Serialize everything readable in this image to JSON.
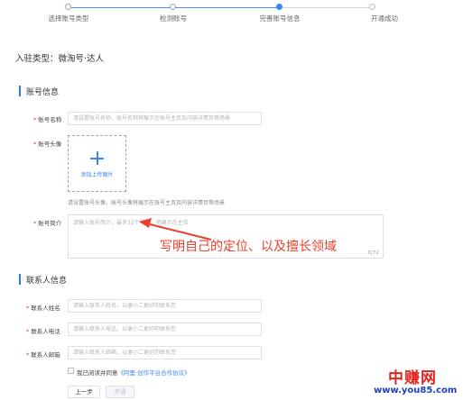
{
  "steps": [
    {
      "label": "选择账号类型",
      "state": "done"
    },
    {
      "label": "检测账号",
      "state": "done"
    },
    {
      "label": "完善账号信息",
      "state": "active"
    },
    {
      "label": "开通成功",
      "state": "todo"
    }
  ],
  "entry_type": "入驻类型：微淘号·达人",
  "account_section": {
    "title": "账号信息",
    "name": {
      "label": "账号名称",
      "placeholder": "请设置账号名称，账号名称将展示在账号主页及内容详情页等场景"
    },
    "avatar": {
      "label": "账号头像",
      "upload_text": "添加上传图片",
      "hint": "请设置账号头像，账号头像将展示在账号主页及内容详情页等场景"
    },
    "intro": {
      "label": "账号简介",
      "placeholder": "请输入账号简介，最多32个字符，将展示在主页",
      "count": "0/72"
    }
  },
  "annotation": "写明自己的定位、以及擅长领域",
  "contact_section": {
    "title": "联系人信息",
    "name": {
      "label": "联系人姓名",
      "placeholder": "请输入联系人姓名，以便小二更好的联系您"
    },
    "phone": {
      "label": "联系人电话",
      "placeholder": "请输入联系人电话，以便小二更好的联系您"
    },
    "email": {
      "label": "联系人邮箱",
      "placeholder": "请输入联系人邮箱，以便小二更好的联系您"
    }
  },
  "agreement": {
    "prefix": "我已阅读并同意",
    "link": "《阿里·创作平台合作协议》"
  },
  "buttons": {
    "prev": "上一步",
    "next": "开通"
  },
  "watermark": {
    "title": "中赚网",
    "url": "www.you85.com"
  },
  "colors": {
    "accent": "#3a86f0",
    "annotation": "#e8402b",
    "required": "#e33"
  }
}
